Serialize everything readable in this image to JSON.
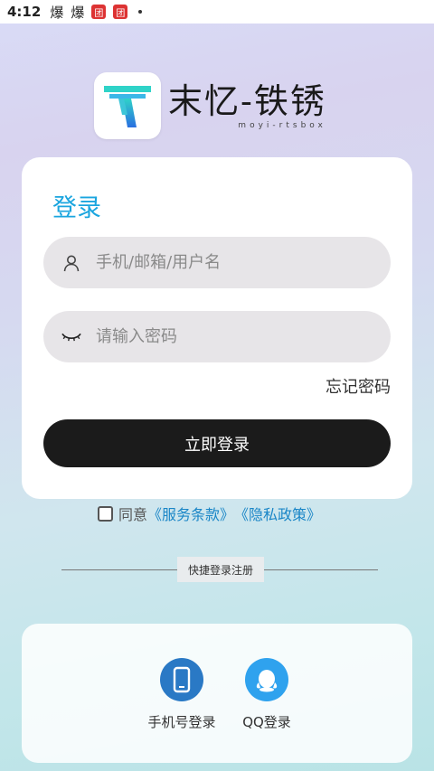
{
  "status_bar": {
    "time": "4:12",
    "icon1": "爆",
    "icon2": "爆",
    "badge1": "团",
    "badge2": "团"
  },
  "brand": {
    "name": "末忆-铁锈",
    "subtitle": "moyi-rtsbox"
  },
  "login": {
    "title": "登录",
    "username_placeholder": "手机/邮箱/用户名",
    "password_placeholder": "请输入密码",
    "forgot_label": "忘记密码",
    "submit_label": "立即登录"
  },
  "agreement": {
    "prefix": "同意",
    "terms": "《服务条款》",
    "privacy": "《隐私政策》"
  },
  "quick": {
    "divider_label": "快捷登录注册",
    "phone_label": "手机号登录",
    "qq_label": "QQ登录"
  },
  "colors": {
    "accent": "#1aa5df",
    "primary_button": "#1b1b1b",
    "phone_icon_bg": "#2a79c5",
    "qq_icon_bg": "#2fa2ee"
  }
}
